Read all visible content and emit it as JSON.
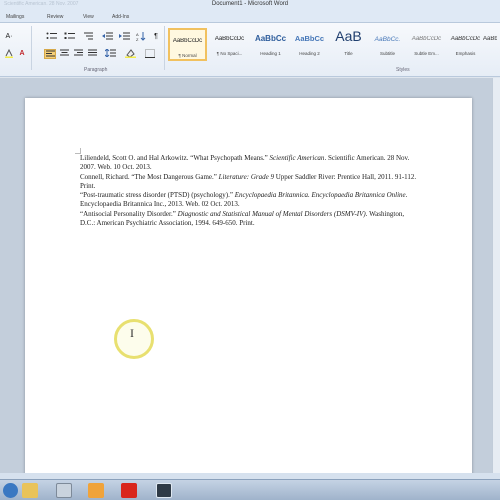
{
  "window": {
    "title": "Document1 - Microsoft Word",
    "faded_title": "Scientific American. 28 Nov. 2007"
  },
  "tabs": [
    "Mailings",
    "Review",
    "View",
    "Add-Ins"
  ],
  "ribbon": {
    "font_size_label": "A·",
    "paragraph_group_label": "Paragraph",
    "styles_group_label": "Styles",
    "pilcrow": "¶",
    "styles": [
      {
        "sample": "AaBbCcDc",
        "name": "¶ Normal"
      },
      {
        "sample": "AaBbCcDc",
        "name": "¶ No Spaci..."
      },
      {
        "sample": "AaBbCc",
        "name": "Heading 1"
      },
      {
        "sample": "AaBbCc",
        "name": "Heading 2"
      },
      {
        "sample": "AaB",
        "name": "Title"
      },
      {
        "sample": "AaBbCc.",
        "name": "Subtitle"
      },
      {
        "sample": "AaBbCcDc",
        "name": "Subtle Em..."
      },
      {
        "sample": "AaBbCcDc",
        "name": "Emphasis"
      },
      {
        "sample": "AaBb",
        "name": ""
      }
    ],
    "accent_color": "#f1c15f"
  },
  "document": {
    "entries": [
      {
        "plain_1": "Liliendeld, Scott O. and Hal Arkowitz. “What Psychopath Means.” ",
        "italic_1": "Scientific American",
        "plain_2": ". Scientific American. 28 Nov. 2007. Web. 10 Oct. 2013."
      },
      {
        "plain_1": "Connell, Richard. “The Most Dangerous Game.” ",
        "italic_1": "Literature: Grade 9",
        "plain_2": " Upper Saddler River: Prentice Hall, 2011. 91-112. Print."
      },
      {
        "plain_1": "“Post-traumatic stress disorder (PTSD) (psychology).” ",
        "italic_1": "Encyclopaedia Britannica. Encyclopaedia Britannica Online",
        "plain_2": ". Encyclopaedia Britannica Inc., 2013. Web. 02 Oct. 2013."
      },
      {
        "plain_1": "“Antisocial Personality Disorder.” ",
        "italic_1": "Diagnostic and Statistical Manual of Mental Disorders (DSMV-IV).",
        "plain_2": " Washington, D.C.: American Psychiatric Association, 1994. 649-650. Print."
      }
    ]
  }
}
